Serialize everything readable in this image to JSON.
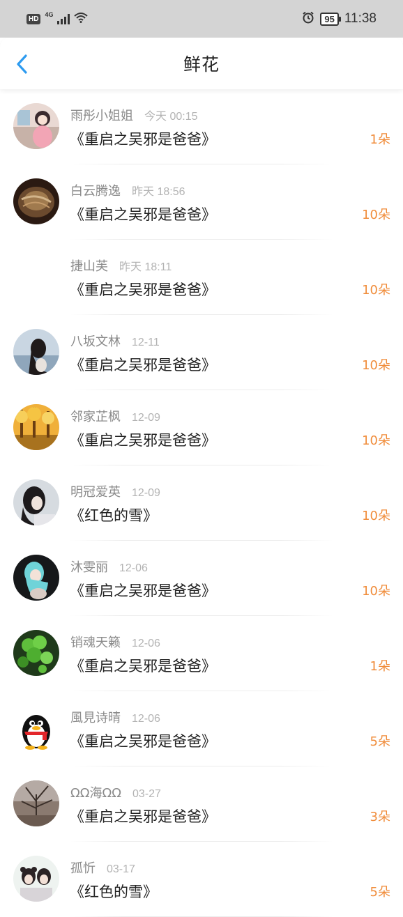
{
  "status_bar": {
    "hd": "HD",
    "network": "4G",
    "battery": "95",
    "time": "11:38"
  },
  "header": {
    "title": "鲜花"
  },
  "items": [
    {
      "user": "雨彤小姐姐",
      "time": "今天 00:15",
      "book": "《重启之吴邪是爸爸》",
      "count": "1朵"
    },
    {
      "user": "白云腾逸",
      "time": "昨天 18:56",
      "book": "《重启之吴邪是爸爸》",
      "count": "10朵"
    },
    {
      "user": "捷山芙",
      "time": "昨天 18:11",
      "book": "《重启之吴邪是爸爸》",
      "count": "10朵"
    },
    {
      "user": "八坂文林",
      "time": "12-11",
      "book": "《重启之吴邪是爸爸》",
      "count": "10朵"
    },
    {
      "user": "邻家芷枫",
      "time": "12-09",
      "book": "《重启之吴邪是爸爸》",
      "count": "10朵"
    },
    {
      "user": "明冠爱英",
      "time": "12-09",
      "book": "《红色的雪》",
      "count": "10朵"
    },
    {
      "user": "沐雯丽",
      "time": "12-06",
      "book": "《重启之吴邪是爸爸》",
      "count": "10朵"
    },
    {
      "user": "销魂天籁",
      "time": "12-06",
      "book": "《重启之吴邪是爸爸》",
      "count": "1朵"
    },
    {
      "user": "風見诗晴",
      "time": "12-06",
      "book": "《重启之吴邪是爸爸》",
      "count": "5朵"
    },
    {
      "user": "ΩΩ海ΩΩ",
      "time": "03-27",
      "book": "《重启之吴邪是爸爸》",
      "count": "3朵"
    },
    {
      "user": "孤忻",
      "time": "03-17",
      "book": "《红色的雪》",
      "count": "5朵"
    }
  ],
  "colors": {
    "accent_blue": "#2d9bf0",
    "count_orange": "#f08c3a"
  }
}
